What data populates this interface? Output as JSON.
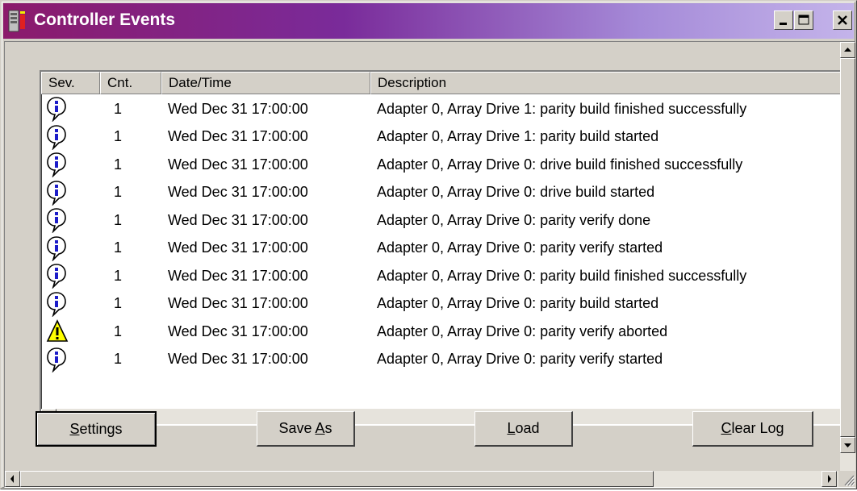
{
  "window": {
    "title": "Controller Events",
    "controls": {
      "minimize": "minimize-icon",
      "maximize": "maximize-icon",
      "close": "close-icon"
    }
  },
  "columns": [
    "Sev.",
    "Cnt.",
    "Date/Time",
    "Description"
  ],
  "events": [
    {
      "severity": "info",
      "count": "1",
      "datetime": "Wed Dec 31 17:00:00",
      "description": "Adapter 0, Array Drive 1: parity build finished successfully"
    },
    {
      "severity": "info",
      "count": "1",
      "datetime": "Wed Dec 31 17:00:00",
      "description": "Adapter 0, Array Drive 1: parity build started"
    },
    {
      "severity": "info",
      "count": "1",
      "datetime": "Wed Dec 31 17:00:00",
      "description": "Adapter 0, Array Drive 0: drive build finished successfully"
    },
    {
      "severity": "info",
      "count": "1",
      "datetime": "Wed Dec 31 17:00:00",
      "description": "Adapter 0, Array Drive 0: drive build started"
    },
    {
      "severity": "info",
      "count": "1",
      "datetime": "Wed Dec 31 17:00:00",
      "description": "Adapter 0, Array Drive 0: parity verify done"
    },
    {
      "severity": "info",
      "count": "1",
      "datetime": "Wed Dec 31 17:00:00",
      "description": "Adapter 0, Array Drive 0: parity verify started"
    },
    {
      "severity": "info",
      "count": "1",
      "datetime": "Wed Dec 31 17:00:00",
      "description": "Adapter 0, Array Drive 0: parity build finished successfully"
    },
    {
      "severity": "info",
      "count": "1",
      "datetime": "Wed Dec 31 17:00:00",
      "description": "Adapter 0, Array Drive 0: parity build started"
    },
    {
      "severity": "warning",
      "count": "1",
      "datetime": "Wed Dec 31 17:00:00",
      "description": "Adapter 0, Array Drive 0: parity verify aborted"
    },
    {
      "severity": "info",
      "count": "1",
      "datetime": "Wed Dec 31 17:00:00",
      "description": "Adapter 0, Array Drive 0: parity verify started"
    }
  ],
  "buttons": {
    "settings": {
      "pre": "",
      "key": "S",
      "post": "ettings"
    },
    "save_as": {
      "pre": "Save ",
      "key": "A",
      "post": "s"
    },
    "load": {
      "pre": "",
      "key": "L",
      "post": "oad"
    },
    "clear_log": {
      "pre": "",
      "key": "C",
      "post": "lear Log"
    }
  },
  "colors": {
    "titlebar_start": "#8b1a6b",
    "titlebar_end": "#c4b4ea",
    "face": "#d4d0c8",
    "info": "#1c1cc8",
    "warning": "#ffff00"
  }
}
